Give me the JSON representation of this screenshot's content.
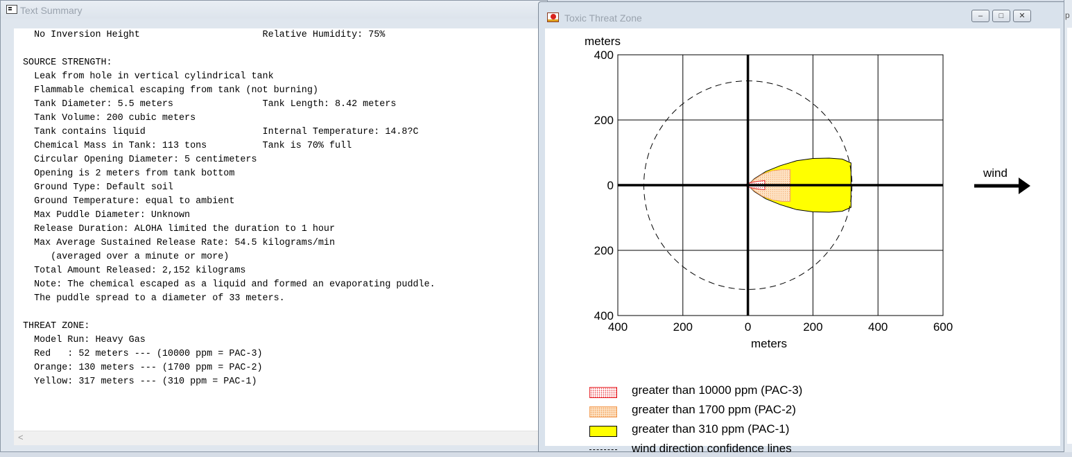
{
  "text_window": {
    "title": "Text Summary",
    "lines": [
      "  No Inversion Height                      Relative Humidity: 75%",
      "",
      "SOURCE STRENGTH:",
      "  Leak from hole in vertical cylindrical tank",
      "  Flammable chemical escaping from tank (not burning)",
      "  Tank Diameter: 5.5 meters                Tank Length: 8.42 meters",
      "  Tank Volume: 200 cubic meters",
      "  Tank contains liquid                     Internal Temperature: 14.8?C",
      "  Chemical Mass in Tank: 113 tons          Tank is 70% full",
      "  Circular Opening Diameter: 5 centimeters",
      "  Opening is 2 meters from tank bottom",
      "  Ground Type: Default soil",
      "  Ground Temperature: equal to ambient",
      "  Max Puddle Diameter: Unknown",
      "  Release Duration: ALOHA limited the duration to 1 hour",
      "  Max Average Sustained Release Rate: 54.5 kilograms/min",
      "     (averaged over a minute or more)",
      "  Total Amount Released: 2,152 kilograms",
      "  Note: The chemical escaped as a liquid and formed an evaporating puddle.",
      "  The puddle spread to a diameter of 33 meters.",
      "",
      "THREAT ZONE:",
      "  Model Run: Heavy Gas",
      "  Red   : 52 meters --- (10000 ppm = PAC-3)",
      "  Orange: 130 meters --- (1700 ppm = PAC-2)",
      "  Yellow: 317 meters --- (310 ppm = PAC-1)"
    ],
    "scroll_left_glyph": "<"
  },
  "chart_window": {
    "title": "Toxic Threat Zone",
    "buttons": {
      "minimize": "–",
      "maximize": "□",
      "close": "✕"
    }
  },
  "chart_data": {
    "type": "area",
    "title": "",
    "xlabel": "meters",
    "ylabel": "meters",
    "xlim": [
      -400,
      600
    ],
    "ylim": [
      -400,
      400
    ],
    "x_tick_values": [
      -400,
      -200,
      0,
      200,
      400,
      600
    ],
    "x_tick_labels": [
      "400",
      "200",
      "0",
      "200",
      "400",
      "600"
    ],
    "y_tick_values": [
      400,
      200,
      0,
      -200,
      -400
    ],
    "y_tick_labels": [
      "400",
      "200",
      "0",
      "200",
      "400"
    ],
    "grid": true,
    "wind_label": "wind",
    "confidence_circle_radius": 320,
    "zones": [
      {
        "name": "greater than 310 ppm (PAC-1)",
        "color": "#ffff00",
        "points": [
          [
            0,
            0
          ],
          [
            20,
            20
          ],
          [
            55,
            42
          ],
          [
            100,
            60
          ],
          [
            150,
            75
          ],
          [
            200,
            82
          ],
          [
            250,
            83
          ],
          [
            290,
            80
          ],
          [
            317,
            68
          ],
          [
            317,
            -68
          ],
          [
            290,
            -80
          ],
          [
            250,
            -83
          ],
          [
            200,
            -82
          ],
          [
            150,
            -75
          ],
          [
            100,
            -60
          ],
          [
            55,
            -42
          ],
          [
            20,
            -20
          ]
        ]
      },
      {
        "name": "greater than 1700 ppm (PAC-2)",
        "color": "#f3a05a",
        "points": [
          [
            0,
            0
          ],
          [
            20,
            18
          ],
          [
            45,
            34
          ],
          [
            75,
            44
          ],
          [
            105,
            48
          ],
          [
            130,
            48
          ],
          [
            130,
            -50
          ],
          [
            105,
            -50
          ],
          [
            75,
            -45
          ],
          [
            45,
            -34
          ],
          [
            20,
            -18
          ]
        ]
      },
      {
        "name": "greater than 10000 ppm (PAC-3)",
        "color": "#e8282e",
        "points": [
          [
            -10,
            0
          ],
          [
            0,
            6
          ],
          [
            15,
            9
          ],
          [
            32,
            12
          ],
          [
            52,
            14
          ],
          [
            52,
            -14
          ],
          [
            32,
            -12
          ],
          [
            15,
            -9
          ],
          [
            0,
            -6
          ]
        ]
      }
    ],
    "legend": [
      {
        "label": "greater than 10000 ppm (PAC-3)"
      },
      {
        "label": "greater than 1700 ppm (PAC-2)"
      },
      {
        "label": "greater than 310 ppm (PAC-1)"
      },
      {
        "label": "wind direction confidence lines"
      }
    ]
  },
  "background_window": {
    "edge_char": "р"
  }
}
